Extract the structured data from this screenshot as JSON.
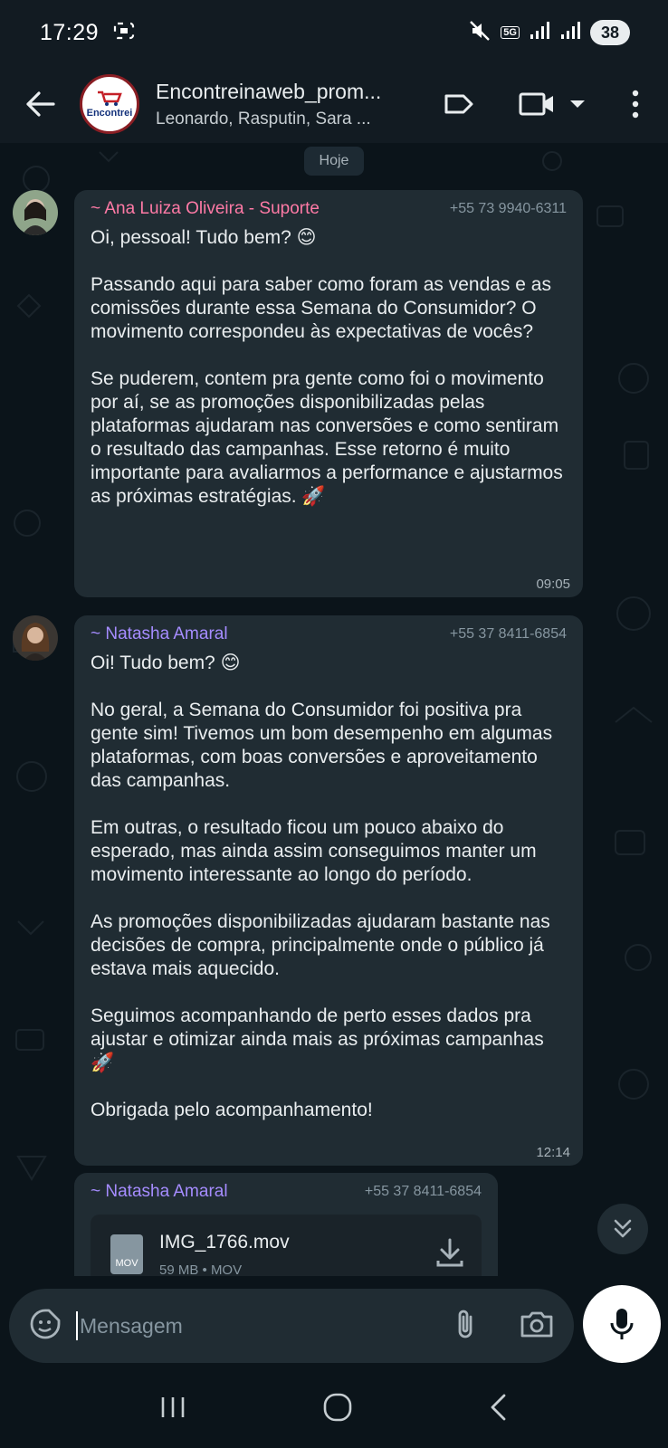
{
  "status": {
    "time": "17:29",
    "network": "5G",
    "battery": "38"
  },
  "header": {
    "title": "Encontreinaweb_prom...",
    "members": "Leonardo, Rasputin, Sara ...",
    "avatar_logo": "Encontrei"
  },
  "chat": {
    "date_label": "Hoje",
    "messages": [
      {
        "sender": "~ Ana Luiza Oliveira - Suporte",
        "phone": "+55 73 9940-6311",
        "sender_color": "#ff7aa6",
        "text": "Oi, pessoal! Tudo bem? 😊\n\nPassando aqui para saber como foram as vendas e as comissões durante essa Semana do Consumidor? O movimento correspondeu às expectativas de vocês?\n\nSe puderem, contem pra gente como foi o movimento por aí, se as promoções disponibilizadas pelas plataformas ajudaram nas conversões e como sentiram o resultado das campanhas. Esse retorno é muito importante para avaliarmos a performance e ajustarmos as próximas estratégias. 🚀",
        "time": "09:05"
      },
      {
        "sender": "~ Natasha Amaral",
        "phone": "+55 37 8411-6854",
        "sender_color": "#a58cff",
        "text": "Oi! Tudo bem? 😊\n\nNo geral, a Semana do Consumidor foi positiva pra gente sim! Tivemos um bom desempenho em algumas plataformas, com boas conversões e aproveitamento das campanhas.\n\nEm outras, o resultado ficou um pouco abaixo do esperado, mas ainda assim conseguimos manter um movimento interessante ao longo do período.\n\nAs promoções disponibilizadas ajudaram bastante nas decisões de compra, principalmente onde o público já estava mais aquecido.\n\nSeguimos acompanhando de perto esses dados pra ajustar e otimizar ainda mais as próximas campanhas 🚀\n\nObrigada pelo acompanhamento!",
        "time": "12:14"
      },
      {
        "sender": "~ Natasha Amaral",
        "phone": "+55 37 8411-6854",
        "sender_color": "#a58cff",
        "file_name": "IMG_1766.mov",
        "file_meta": "59 MB • MOV",
        "file_badge": "MOV"
      }
    ]
  },
  "composer": {
    "placeholder": "Mensagem"
  }
}
